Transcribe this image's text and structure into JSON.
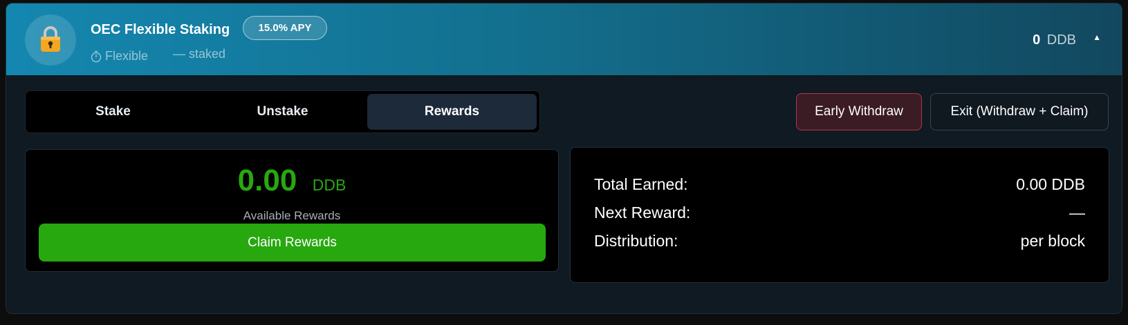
{
  "pool": {
    "name": "OEC Flexible Staking",
    "apy_badge": "15.0% APY",
    "type_icon": "timer-icon",
    "type_label": "Flexible",
    "staked_label": "— staked",
    "balance_amount": "0",
    "balance_unit": "DDB",
    "collapse_glyph": "▲"
  },
  "tabs": [
    {
      "label": "Stake",
      "active": false
    },
    {
      "label": "Unstake",
      "active": false
    },
    {
      "label": "Rewards",
      "active": true
    }
  ],
  "actions": {
    "early_withdraw": "Early Withdraw",
    "exit": "Exit (Withdraw + Claim)"
  },
  "rewards": {
    "amount": "0.00",
    "unit": "DDB",
    "label": "Available Rewards",
    "claim_button": "Claim Rewards"
  },
  "stats": [
    {
      "label": "Total Earned:",
      "value": "0.00 DDB"
    },
    {
      "label": "Next Reward:",
      "value": "—"
    },
    {
      "label": "Distribution:",
      "value": "per block"
    }
  ],
  "colors": {
    "accent_green": "#27a80f",
    "danger_border": "#b2364a",
    "header_start": "#1487b0",
    "header_end": "#12485f"
  }
}
